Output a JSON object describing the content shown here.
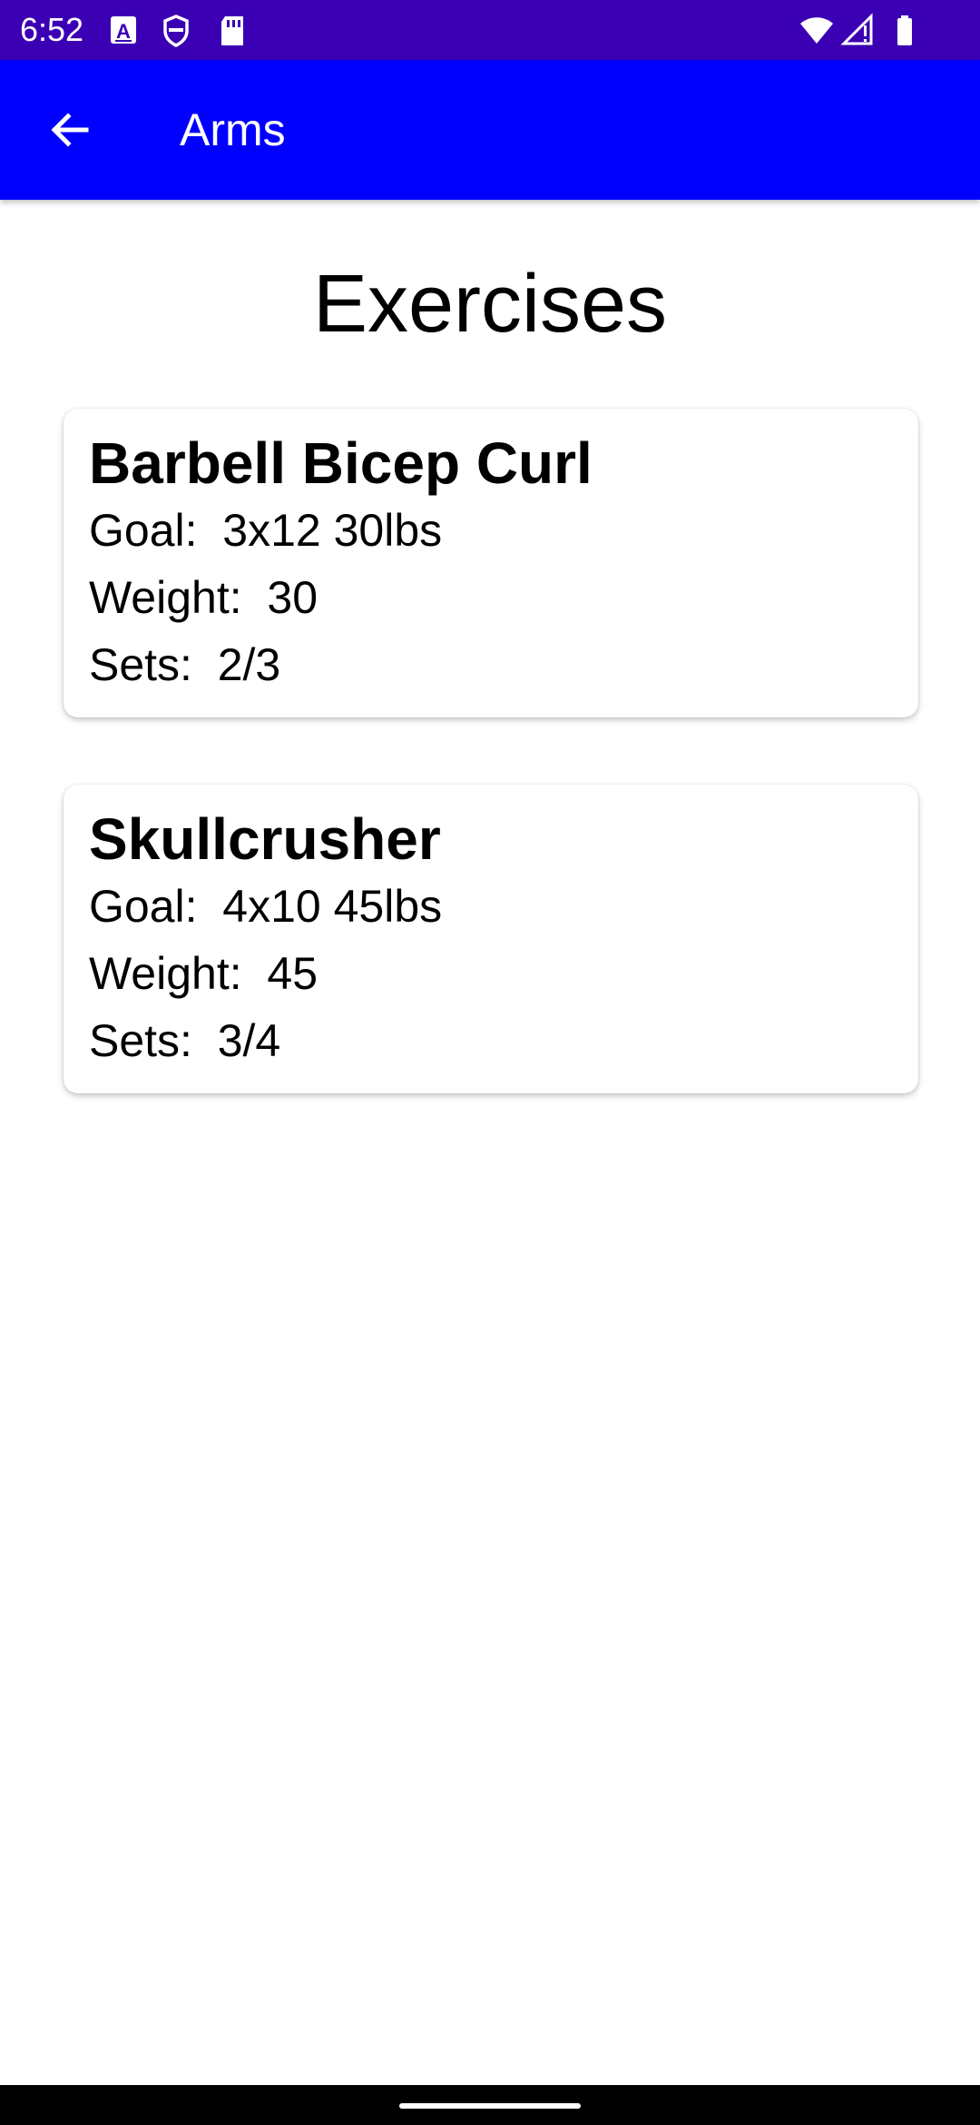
{
  "status_bar": {
    "time": "6:52",
    "left_icons": [
      "text-a-icon",
      "shield-badge-icon",
      "sd-card-icon"
    ],
    "right_icons": [
      "wifi-icon",
      "signal-icon",
      "battery-icon"
    ],
    "background": "#3b00b3"
  },
  "app_bar": {
    "title": "Arms",
    "background": "#0000ff"
  },
  "heading": "Exercises",
  "exercises": [
    {
      "name": "Barbell Bicep Curl",
      "goal": "Goal:  3x12 30lbs",
      "weight": "Weight:  30",
      "sets": "Sets:  2/3"
    },
    {
      "name": "Skullcrusher",
      "goal": "Goal:  4x10 45lbs",
      "weight": "Weight:  45",
      "sets": "Sets:  3/4"
    }
  ]
}
